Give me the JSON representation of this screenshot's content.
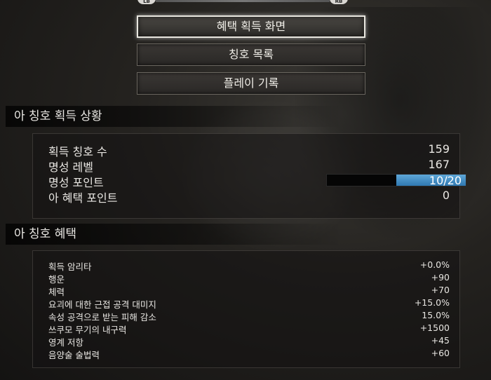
{
  "controller": {
    "lb": "LB",
    "rb": "RB"
  },
  "menu": [
    {
      "label": "혜택 획득 화면",
      "active": true
    },
    {
      "label": "칭호 목록",
      "active": false
    },
    {
      "label": "플레이 기록",
      "active": false
    }
  ],
  "status": {
    "title": "아 칭호 획득 상황",
    "rows": [
      {
        "label": "획득 칭호 수",
        "value": "159"
      },
      {
        "label": "명성 레벨",
        "value": "167"
      },
      {
        "label": "명성 포인트",
        "value": "10/20",
        "progress": 0.5
      },
      {
        "label": "아 혜택 포인트",
        "value": "0"
      }
    ]
  },
  "benefits": {
    "title": "아 칭호 혜택",
    "rows": [
      {
        "label": "획득 암리타",
        "value": "+0.0%"
      },
      {
        "label": "행운",
        "value": "+90"
      },
      {
        "label": "체력",
        "value": "+70"
      },
      {
        "label": "요괴에 대한 근접 공격 대미지",
        "value": "+15.0%"
      },
      {
        "label": "속성 공격으로 받는 피해 감소",
        "value": "15.0%"
      },
      {
        "label": "쓰쿠모 무기의 내구력",
        "value": "+1500"
      },
      {
        "label": "영계 저항",
        "value": "+45"
      },
      {
        "label": "음양술 술법력",
        "value": "+60"
      }
    ]
  }
}
